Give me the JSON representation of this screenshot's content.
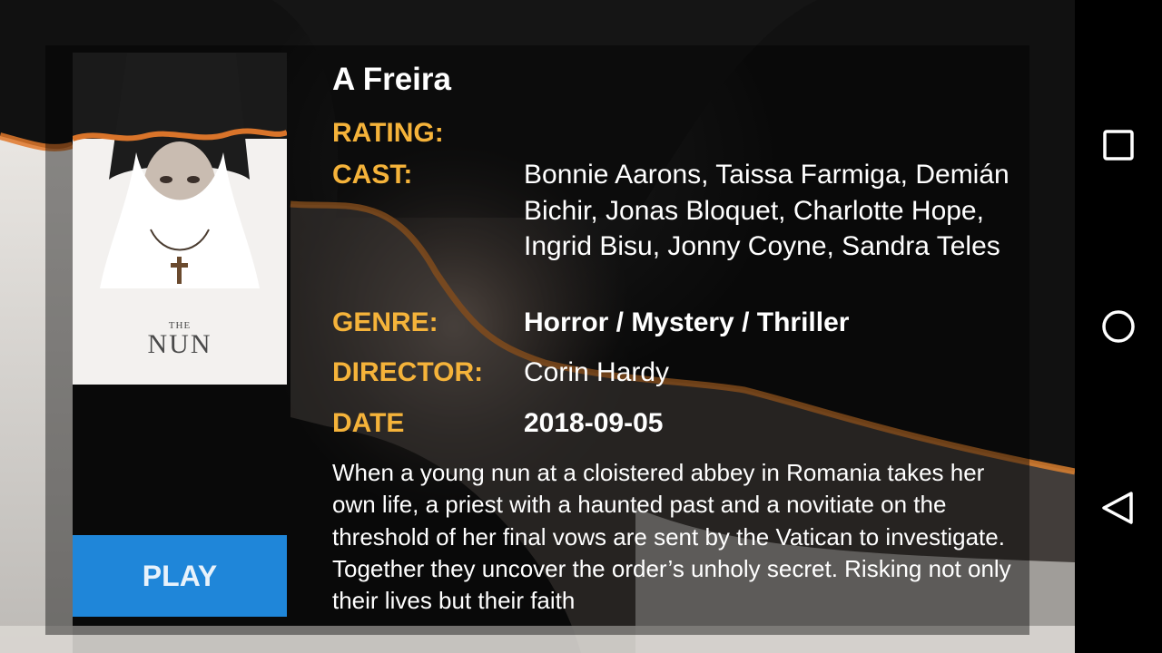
{
  "movie": {
    "title": "A Freira",
    "rating_label": "RATING:",
    "rating_value": "",
    "cast_label": "CAST:",
    "cast_value": "Bonnie Aarons, Taissa Farmiga, Demián Bichir, Jonas Bloquet, Charlotte Hope, Ingrid Bisu, Jonny Coyne, Sandra Teles",
    "genre_label": "GENRE:",
    "genre_value": "Horror / Mystery / Thriller",
    "director_label": "DIRECTOR:",
    "director_value": "Corin Hardy",
    "date_label": "DATE",
    "date_value": "2018-09-05",
    "description": "When a young nun at a cloistered abbey in Romania takes her own life, a priest with a haunted past and a novitiate on the threshold of her final vows are sent by the Vatican to investigate. Together they uncover the order’s unholy secret. Risking not only their lives but their faith"
  },
  "poster": {
    "logo_the": "THE",
    "logo_nun": "NUN",
    "icon": "nun-poster-image"
  },
  "actions": {
    "play_label": "PLAY"
  },
  "navbar": {
    "recents_icon": "square-recents-icon",
    "home_icon": "circle-home-icon",
    "back_icon": "triangle-back-icon"
  },
  "colors": {
    "accent_label": "#f5b33a",
    "play_button": "#1f86d9",
    "panel_overlay": "rgba(0,0,0,0.42)",
    "navbar": "#000000"
  }
}
